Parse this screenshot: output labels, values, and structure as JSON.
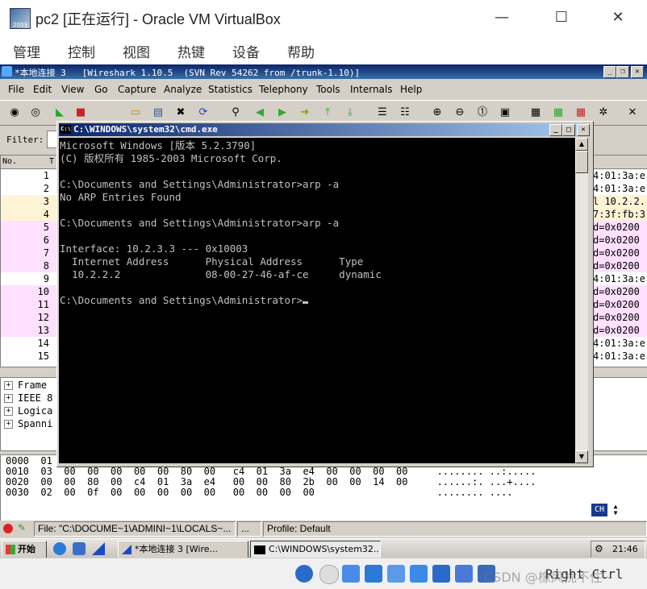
{
  "vbox": {
    "title": "pc2 [正在运行] - Oracle VM VirtualBox",
    "menu": [
      "管理",
      "控制",
      "视图",
      "热键",
      "设备",
      "帮助"
    ],
    "host_key": "Right Ctrl",
    "watermark": "CSDN @橡风扰不住~"
  },
  "wireshark": {
    "title": "*本地连接 3   [Wireshark 1.10.5  (SVN Rev 54262 from /trunk-1.10)]",
    "menu": [
      "File",
      "Edit",
      "View",
      "Go",
      "Capture",
      "Analyze",
      "Statistics",
      "Telephony",
      "Tools",
      "Internals",
      "Help"
    ],
    "filter_label": "Filter:",
    "col_no": "No.",
    "col_time": "T",
    "packets": [
      {
        "no": "1",
        "bg": "#ffffff",
        "info": "4:01:3a:e"
      },
      {
        "no": "2",
        "bg": "#ffffff",
        "info": "4:01:3a:e"
      },
      {
        "no": "3",
        "bg": "#fff3d6",
        "info": "l 10.2.2."
      },
      {
        "no": "4",
        "bg": "#fff3d6",
        "info": "7:3f:fb:3"
      },
      {
        "no": "5",
        "bg": "#ffe0ff",
        "info": "d=0x0200"
      },
      {
        "no": "6",
        "bg": "#ffe0ff",
        "info": "d=0x0200"
      },
      {
        "no": "7",
        "bg": "#ffe0ff",
        "info": "d=0x0200"
      },
      {
        "no": "8",
        "bg": "#ffe0ff",
        "info": "d=0x0200"
      },
      {
        "no": "9",
        "bg": "#ffffff",
        "info": "4:01:3a:e"
      },
      {
        "no": "10",
        "bg": "#ffe0ff",
        "info": "d=0x0200"
      },
      {
        "no": "11",
        "bg": "#ffe0ff",
        "info": "d=0x0200"
      },
      {
        "no": "12",
        "bg": "#ffe0ff",
        "info": "d=0x0200"
      },
      {
        "no": "13",
        "bg": "#ffe0ff",
        "info": "d=0x0200"
      },
      {
        "no": "14",
        "bg": "#ffffff",
        "info": "4:01:3a:e"
      },
      {
        "no": "15",
        "bg": "#ffffff",
        "info": "4:01:3a:e"
      }
    ],
    "details": [
      "Frame",
      "IEEE 8",
      "Logica",
      "Spanni"
    ],
    "bytes": [
      "0000  01",
      "0010  03  00  00  00  00  00  80  00   c4  01  3a  e4  00  00  00  00     ........ ..:.....",
      "0020  00  00  80  00  c4  01  3a  e4   00  00  80  2b  00  00  14  00     ......:. ...+....",
      "0030  02  00  0f  00  00  00  00  00   00  00  00  00                     ........ ...."
    ],
    "status_file": "File: \"C:\\DOCUME~1\\ADMINI~1\\LOCALS~...",
    "status_mid": "...",
    "status_profile": "Profile: Default",
    "ime": "CH"
  },
  "cmd": {
    "title": "C:\\WINDOWS\\system32\\cmd.exe",
    "lines": [
      "Microsoft Windows [版本 5.2.3790]",
      "(C) 版权所有 1985-2003 Microsoft Corp.",
      "",
      "C:\\Documents and Settings\\Administrator>arp -a",
      "No ARP Entries Found",
      "",
      "C:\\Documents and Settings\\Administrator>arp -a",
      "",
      "Interface: 10.2.3.3 --- 0x10003",
      "  Internet Address      Physical Address      Type",
      "  10.2.2.2              08-00-27-46-af-ce     dynamic",
      "",
      "C:\\Documents and Settings\\Administrator>"
    ]
  },
  "taskbar": {
    "start": "开始",
    "task1": "*本地连接 3   [Wire...",
    "task2": "C:\\WINDOWS\\system32...",
    "clock": "21:46"
  }
}
